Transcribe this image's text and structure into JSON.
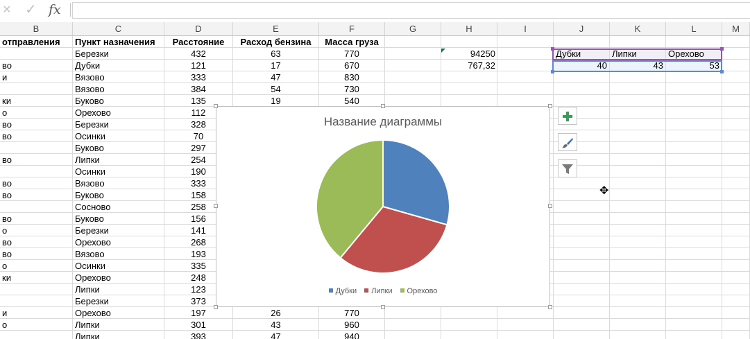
{
  "formula_bar": {
    "cancel_icon": "×",
    "enter_icon": "✓",
    "fx_label": "fx",
    "value": ""
  },
  "columns": [
    "B",
    "C",
    "D",
    "E",
    "F",
    "G",
    "H",
    "I",
    "J",
    "K",
    "L",
    "M"
  ],
  "headers": {
    "b": "отправления",
    "c": "Пункт назначения",
    "d": "Расстояние",
    "e": "Расход бензина",
    "f": "Масса груза"
  },
  "rows": [
    {
      "b": "",
      "c": "Березки",
      "d": "432",
      "e": "63",
      "f": "770"
    },
    {
      "b": "во",
      "c": "Дубки",
      "d": "121",
      "e": "17",
      "f": "670"
    },
    {
      "b": "и",
      "c": "Вязово",
      "d": "333",
      "e": "47",
      "f": "830"
    },
    {
      "b": "",
      "c": "Вязово",
      "d": "384",
      "e": "54",
      "f": "730"
    },
    {
      "b": "ки",
      "c": "Буково",
      "d": "135",
      "e": "19",
      "f": "540"
    },
    {
      "b": "о",
      "c": "Орехово",
      "d": "112",
      "e": "",
      "f": ""
    },
    {
      "b": "во",
      "c": "Березки",
      "d": "328",
      "e": "",
      "f": ""
    },
    {
      "b": "во",
      "c": "Осинки",
      "d": "70",
      "e": "",
      "f": ""
    },
    {
      "b": "",
      "c": "Буково",
      "d": "297",
      "e": "",
      "f": ""
    },
    {
      "b": "во",
      "c": "Липки",
      "d": "254",
      "e": "",
      "f": ""
    },
    {
      "b": "",
      "c": "Осинки",
      "d": "190",
      "e": "",
      "f": ""
    },
    {
      "b": "во",
      "c": "Вязово",
      "d": "333",
      "e": "",
      "f": ""
    },
    {
      "b": "во",
      "c": "Буково",
      "d": "158",
      "e": "",
      "f": ""
    },
    {
      "b": "",
      "c": "Сосново",
      "d": "258",
      "e": "",
      "f": ""
    },
    {
      "b": "во",
      "c": "Буково",
      "d": "156",
      "e": "",
      "f": ""
    },
    {
      "b": "о",
      "c": "Березки",
      "d": "141",
      "e": "",
      "f": ""
    },
    {
      "b": "во",
      "c": "Орехово",
      "d": "268",
      "e": "",
      "f": ""
    },
    {
      "b": "во",
      "c": "Вязово",
      "d": "193",
      "e": "",
      "f": ""
    },
    {
      "b": "о",
      "c": "Осинки",
      "d": "335",
      "e": "",
      "f": ""
    },
    {
      "b": "ки",
      "c": "Орехово",
      "d": "248",
      "e": "",
      "f": ""
    },
    {
      "b": "",
      "c": "Липки",
      "d": "123",
      "e": "",
      "f": ""
    },
    {
      "b": "",
      "c": "Березки",
      "d": "373",
      "e": "",
      "f": ""
    },
    {
      "b": "и",
      "c": "Орехово",
      "d": "197",
      "e": "26",
      "f": "770"
    },
    {
      "b": "о",
      "c": "Липки",
      "d": "301",
      "e": "43",
      "f": "960"
    },
    {
      "b": "",
      "c": "Липки",
      "d": "393",
      "e": "47",
      "f": "940"
    }
  ],
  "h_values": [
    "94250",
    "767,32"
  ],
  "summary": {
    "labels": [
      "Дубки",
      "Липки",
      "Орехово"
    ],
    "values": [
      "40",
      "43",
      "53"
    ]
  },
  "chart_data": {
    "type": "pie",
    "title": "Название диаграммы",
    "categories": [
      "Дубки",
      "Липки",
      "Орехово"
    ],
    "values": [
      40,
      43,
      53
    ],
    "colors": [
      "#4f81bd",
      "#c0504d",
      "#9bbb59"
    ],
    "legend": "bottom"
  },
  "chart_tools": [
    {
      "name": "chart-elements-icon",
      "glyph": "+"
    },
    {
      "name": "chart-styles-icon",
      "glyph": "brush"
    },
    {
      "name": "chart-filters-icon",
      "glyph": "funnel"
    }
  ],
  "cursor_icon": "✥"
}
